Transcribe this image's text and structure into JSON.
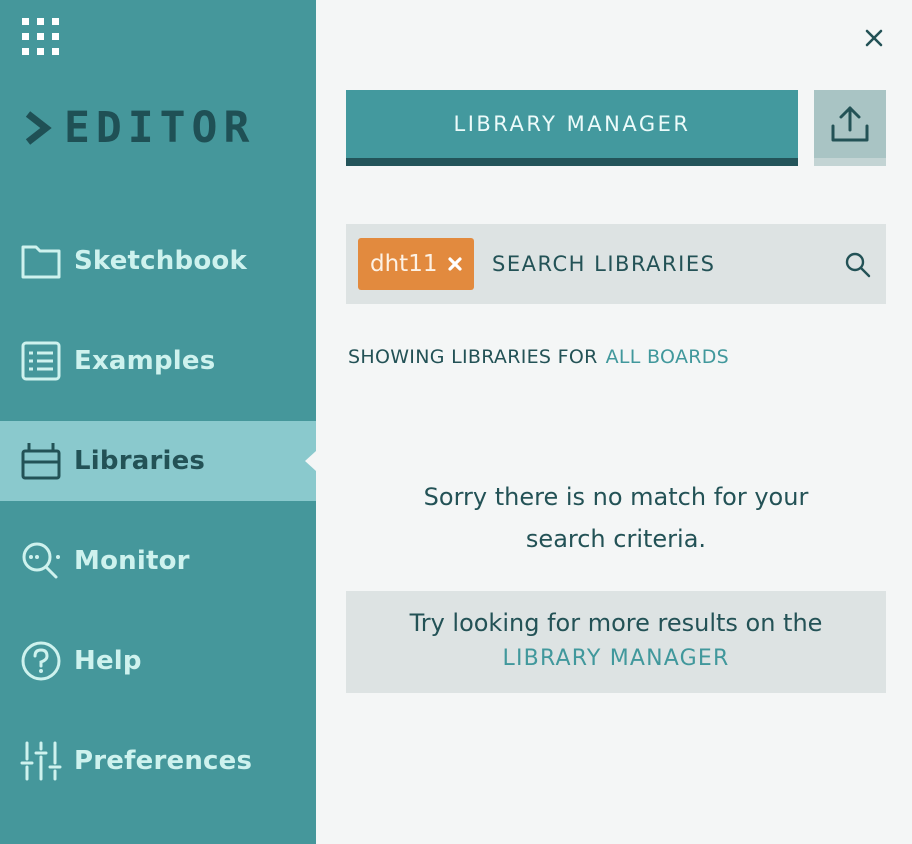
{
  "app": {
    "logo_text": "EDITOR"
  },
  "sidebar": {
    "items": [
      {
        "label": "Sketchbook",
        "icon": "folder-icon",
        "active": false
      },
      {
        "label": "Examples",
        "icon": "list-icon",
        "active": false
      },
      {
        "label": "Libraries",
        "icon": "library-icon",
        "active": true
      },
      {
        "label": "Monitor",
        "icon": "monitor-icon",
        "active": false
      },
      {
        "label": "Help",
        "icon": "help-icon",
        "active": false
      },
      {
        "label": "Preferences",
        "icon": "sliders-icon",
        "active": false
      }
    ]
  },
  "panel": {
    "library_manager_button": "LIBRARY MANAGER",
    "search": {
      "chip_label": "dht11",
      "placeholder": "SEARCH LIBRARIES",
      "value": ""
    },
    "filter": {
      "prefix": "SHOWING LIBRARIES FOR",
      "link": "ALL BOARDS"
    },
    "empty_message_line1": "Sorry there is no match for your",
    "empty_message_line2": "search criteria.",
    "hint_text": "Try looking for more results on the",
    "hint_link": "LIBRARY MANAGER"
  },
  "colors": {
    "sidebar_bg": "#45979b",
    "active_item_bg": "#8ac9cd",
    "chip_bg": "#e28a3e",
    "accent_link": "#41989c",
    "text_dark": "#235256"
  }
}
